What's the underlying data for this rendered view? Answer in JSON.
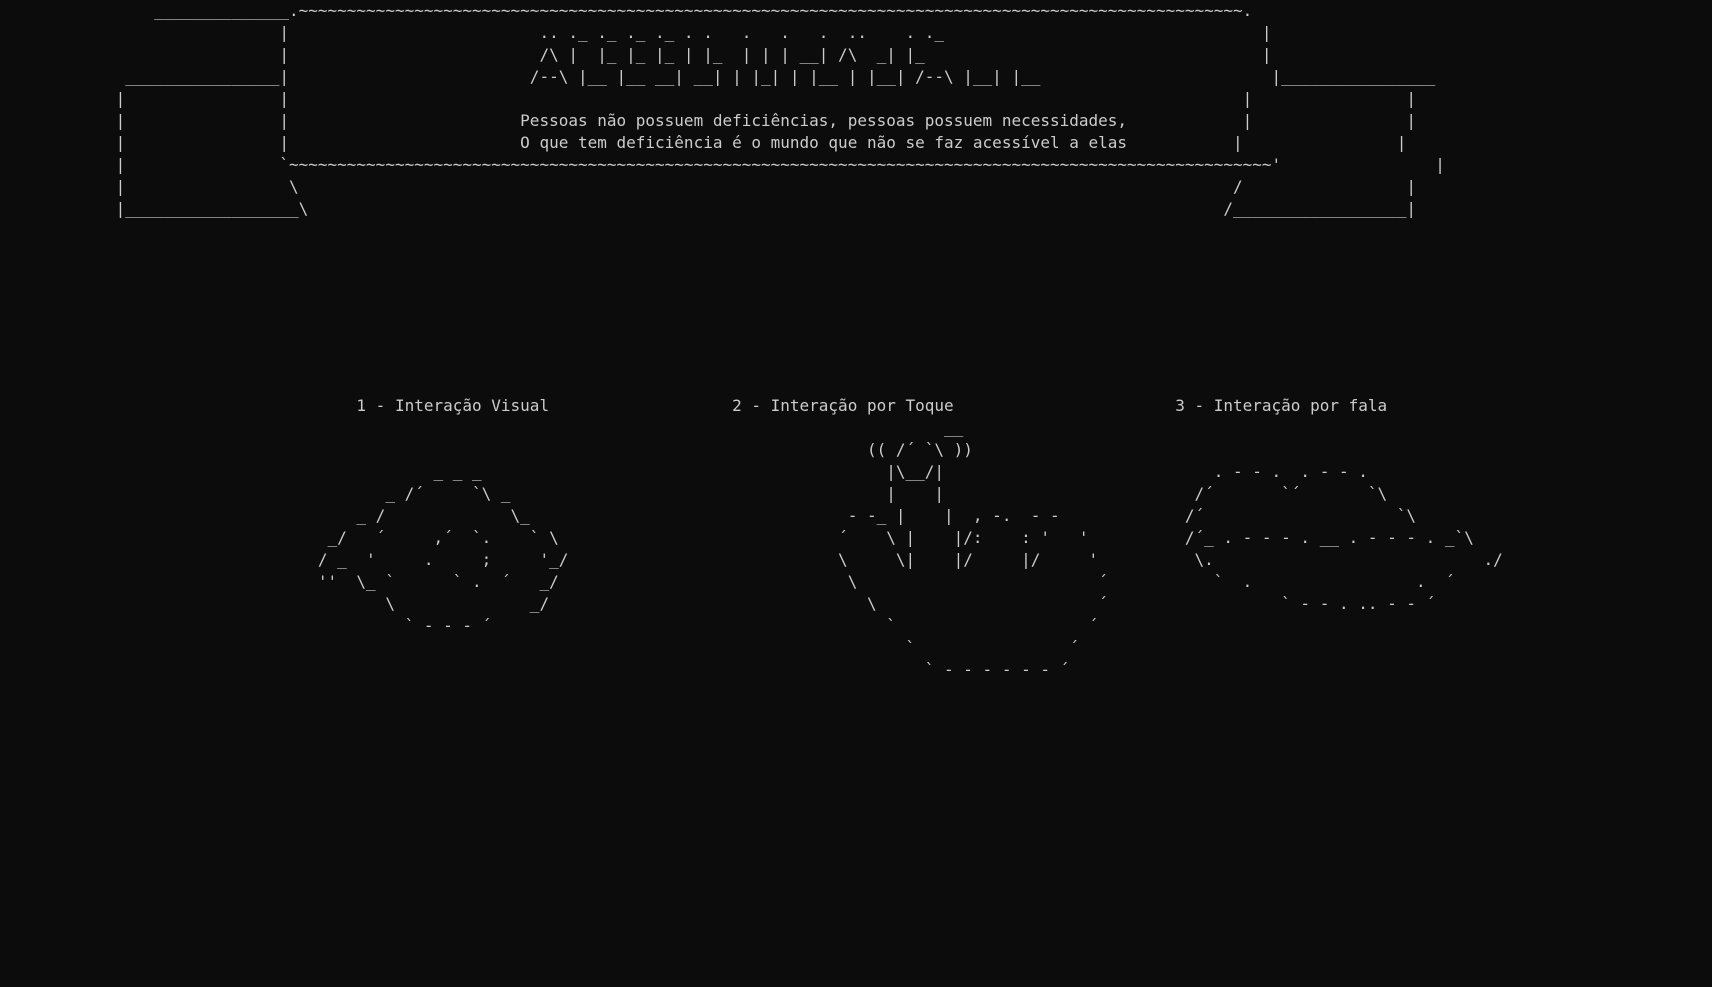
{
  "banner": {
    "art": "                ______________.~~~~~~~~~~~~~~~~~~~~~~~~~~~~~~~~~~~~~~~~~~~~~~~~~~~~~~~~~~~~~~~~~~~~~~~~~~~~~~~~~~~~~~~~~~~~~~~~~~.\n                             |                          .. ._ ._ ._ ._ . .   .   .   .  ..    . ._                                 |\n                             |                          /\\ |  |_ |_ |_ | |_  | | | __| /\\  _| |_                                   |\n             ________________|                         /--\\ |__ |__ __| __| | |_| | |__ | |__| /--\\ |__| |__                        |________________\n            |                |                                                                                                   |                |\n            |                |                        Pessoas não possuem deficiências, pessoas possuem necessidades,            |                |\n            |                |                        O que tem deficiência é o mundo que não se faz acessível a elas           |                |\n            |                `~~~~~~~~~~~~~~~~~~~~~~~~~~~~~~~~~~~~~~~~~~~~~~~~~~~~~~~~~~~~~~~~~~~~~~~~~~~~~~~~~~~~~~~~~~~~~~~~~~~~~~'                |\n            |                 \\                                                                                                 /                 |\n            |__________________\\                                                                                               /__________________|"
  },
  "options": {
    "art": "                                     1 - Interação Visual                   2 - Interação por Toque                       3 - Interação por fala\n                                                                                                  __\n                                                                                          (( /´ `\\ ))\n                                             _ _ _                                          |\\__/|                            . - - .  . - - .\n                                        _ /´     `\\ _                                       |    |                          /´       `´       `\\\n                                     _ /             \\_                                 - -_ |    |  , -.  - -             /´                    `\\\n                                  _/   ´     ,´  `.    ` \\                             ´    \\ |    |/:    : '   '          /´_ . - - - . __ . - - - . _`\\\n                                 / _  '     .     ;     '_/                            \\     \\|    |/     |/     '          \\.                            ./\n                                 ''  \\_ `      ` .  ´   _/                              \\                         ´           `  .                 .  ´\n                                        \\              _/                                 \\                       ´                  ` - - . .. - - ´\n                                          ` - - - ´                                         `                    ´\n                                                                                              `                ´\n                                                                                                ` - - - - - - ´"
  }
}
